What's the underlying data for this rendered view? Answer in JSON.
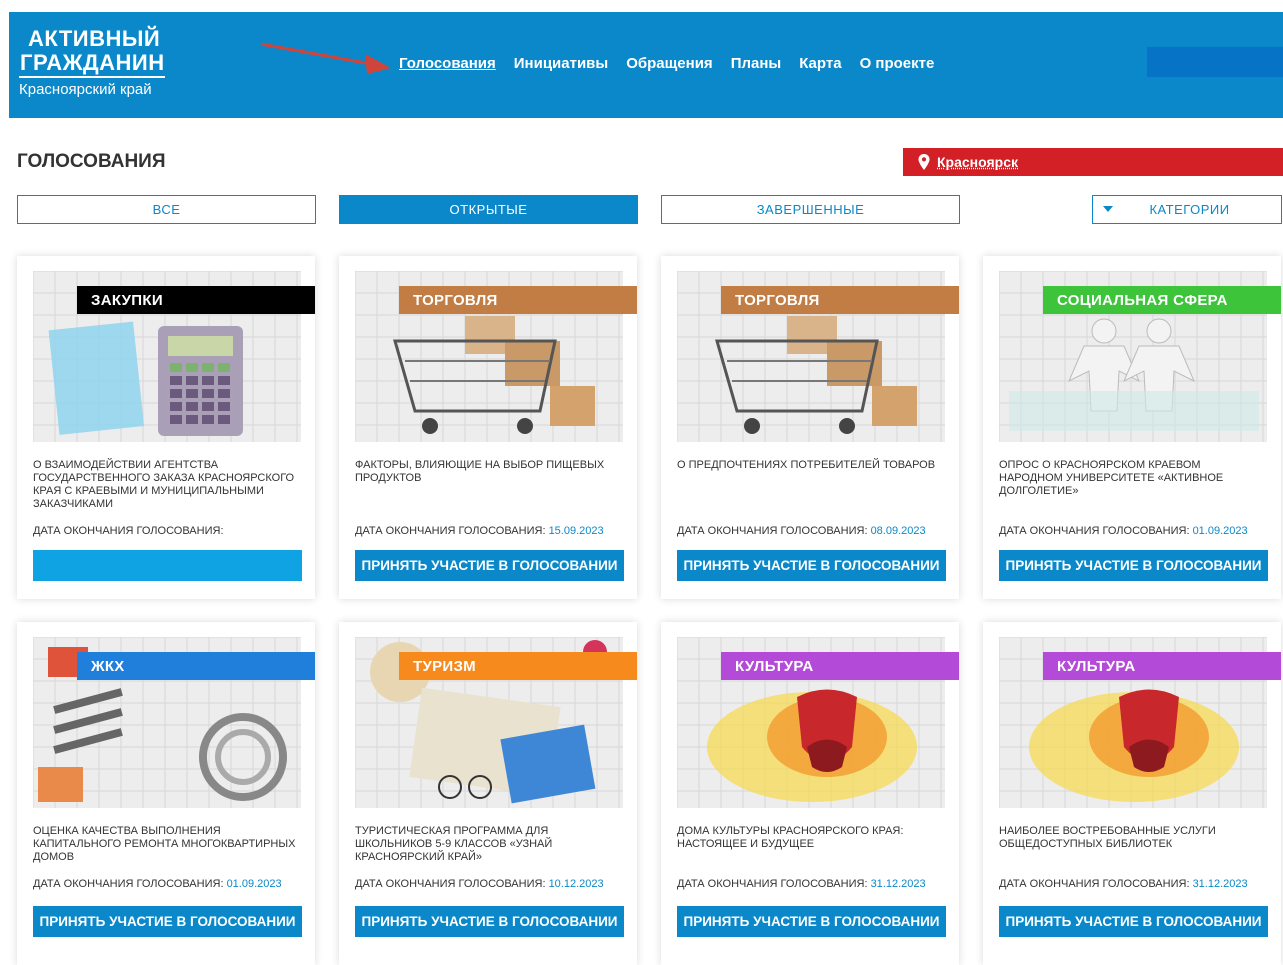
{
  "header": {
    "logo_line1": "АКТИВНЫЙ",
    "logo_line2": "ГРАЖДАНИН",
    "logo_line3": "Красноярский край",
    "nav": [
      "Голосования",
      "Инициативы",
      "Обращения",
      "Планы",
      "Карта",
      "О проекте"
    ],
    "active_nav": "Голосования",
    "bg_color": "#0a88c9"
  },
  "page": {
    "title": "ГОЛОСОВАНИЯ",
    "city": "Красноярск",
    "city_color": "#d31f26"
  },
  "filters": {
    "all": "ВСЕ",
    "open": "ОТКРЫТЫЕ",
    "finished": "ЗАВЕРШЕННЫЕ",
    "categories": "КАТЕГОРИИ",
    "active": "ОТКРЫТЫЕ"
  },
  "date_label": "ДАТА ОКОНЧАНИЯ ГОЛОСОВАНИЯ:",
  "vote_button": "ПРИНЯТЬ УЧАСТИЕ В ГОЛОСОВАНИИ",
  "cards": [
    {
      "category": "ЗАКУПКИ",
      "color": "#000000",
      "icon": "calculator-icon",
      "title": "О ВЗАИМОДЕЙСТВИИ АГЕНТСТВА ГОСУДАРСТВЕННОГО ЗАКАЗА КРАСНОЯРСКОГО КРАЯ С КРАЕВЫМИ И МУНИЦИПАЛЬНЫМИ ЗАКАЗЧИКАМИ",
      "date": "",
      "button": ""
    },
    {
      "category": "ТОРГОВЛЯ",
      "color": "#c17d43",
      "icon": "shopping-cart-icon",
      "title": "ФАКТОРЫ, ВЛИЯЮЩИЕ НА ВЫБОР ПИЩЕВЫХ ПРОДУКТОВ",
      "date": "15.09.2023",
      "button": "ПРИНЯТЬ УЧАСТИЕ В ГОЛОСОВАНИИ"
    },
    {
      "category": "ТОРГОВЛЯ",
      "color": "#c17d43",
      "icon": "shopping-cart-icon",
      "title": "О ПРЕДПОЧТЕНИЯХ ПОТРЕБИТЕЛЕЙ ТОВАРОВ",
      "date": "08.09.2023",
      "button": "ПРИНЯТЬ УЧАСТИЕ В ГОЛОСОВАНИИ"
    },
    {
      "category": "СОЦИАЛЬНАЯ СФЕРА",
      "color": "#3dc43a",
      "icon": "people-icon",
      "title": "ОПРОС О КРАСНОЯРСКОМ КРАЕВОМ НАРОДНОМ УНИВЕРСИТЕТЕ «АКТИВНОЕ ДОЛГОЛЕТИЕ»",
      "date": "01.09.2023",
      "button": "ПРИНЯТЬ УЧАСТИЕ В ГОЛОСОВАНИИ"
    },
    {
      "category": "ЖКХ",
      "color": "#1f7fdb",
      "icon": "wrench-icon",
      "title": "ОЦЕНКА КАЧЕСТВА ВЫПОЛНЕНИЯ КАПИТАЛЬНОГО РЕМОНТА МНОГОКВАРТИРНЫХ ДОМОВ",
      "date": "01.09.2023",
      "button": "ПРИНЯТЬ УЧАСТИЕ В ГОЛОСОВАНИИ"
    },
    {
      "category": "ТУРИЗМ",
      "color": "#f78a1c",
      "icon": "map-travel-icon",
      "title": "ТУРИСТИЧЕСКАЯ ПРОГРАММА ДЛЯ ШКОЛЬНИКОВ 5-9 КЛАССОВ «УЗНАЙ КРАСНОЯРСКИЙ КРАЙ»",
      "date": "10.12.2023",
      "button": "ПРИНЯТЬ УЧАСТИЕ В ГОЛОСОВАНИИ"
    },
    {
      "category": "КУЛЬТУРА",
      "color": "#b44ad8",
      "icon": "theater-mask-icon",
      "title": "ДОМА КУЛЬТУРЫ КРАСНОЯРСКОГО КРАЯ: НАСТОЯЩЕЕ И БУДУЩЕЕ",
      "date": "31.12.2023",
      "button": "ПРИНЯТЬ УЧАСТИЕ В ГОЛОСОВАНИИ"
    },
    {
      "category": "КУЛЬТУРА",
      "color": "#b44ad8",
      "icon": "theater-mask-icon",
      "title": "НАИБОЛЕЕ ВОСТРЕБОВАННЫЕ УСЛУГИ ОБЩЕДОСТУПНЫХ БИБЛИОТЕК",
      "date": "31.12.2023",
      "button": "ПРИНЯТЬ УЧАСТИЕ В ГОЛОСОВАНИИ"
    }
  ]
}
